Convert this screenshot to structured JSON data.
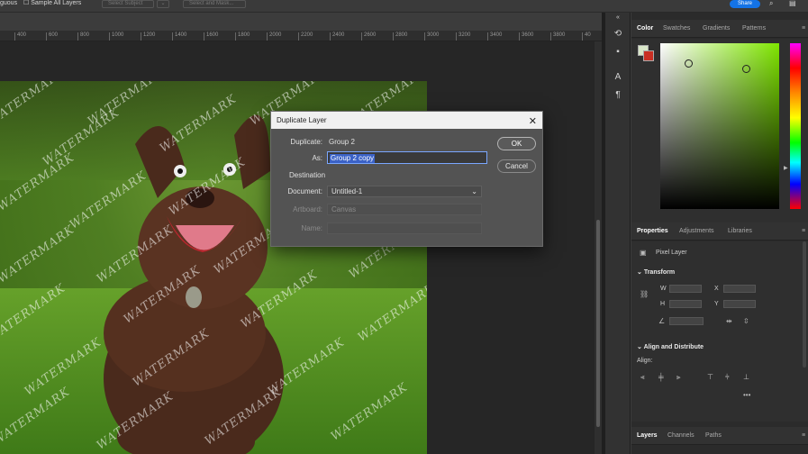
{
  "options_bar": {
    "left_label": "guous",
    "sample_all_layers": "Sample All Layers",
    "select_subject": "Select Subject",
    "select_and_mask": "Select and Mask...",
    "share": "Share"
  },
  "ruler": {
    "ticks": [
      "400",
      "600",
      "800",
      "1000",
      "1200",
      "1400",
      "1600",
      "1800",
      "2000",
      "2200",
      "2400",
      "2600",
      "2800",
      "3000",
      "3200",
      "3400",
      "3600",
      "3800",
      "40"
    ]
  },
  "canvas": {
    "watermark_text": "WATERMARK"
  },
  "dialog": {
    "title": "Duplicate Layer",
    "duplicate_label": "Duplicate:",
    "duplicate_value": "Group 2",
    "as_label": "As:",
    "as_value": "Group 2 copy",
    "destination_label": "Destination",
    "document_label": "Document:",
    "document_value": "Untitled-1",
    "artboard_label": "Artboard:",
    "artboard_value": "Canvas",
    "name_label": "Name:",
    "ok": "OK",
    "cancel": "Cancel"
  },
  "color_panel": {
    "tabs": [
      "Color",
      "Swatches",
      "Gradients",
      "Patterns"
    ],
    "foreground": "#d8e6c8",
    "background": "#c92f23"
  },
  "properties_panel": {
    "tabs": [
      "Properties",
      "Adjustments",
      "Libraries"
    ],
    "layer_type": "Pixel Layer",
    "transform_label": "Transform",
    "w_label": "W",
    "h_label": "H",
    "x_label": "X",
    "y_label": "Y",
    "align_section": "Align and Distribute",
    "align_label": "Align:"
  },
  "layers_panel": {
    "tabs": [
      "Layers",
      "Channels",
      "Paths"
    ]
  }
}
